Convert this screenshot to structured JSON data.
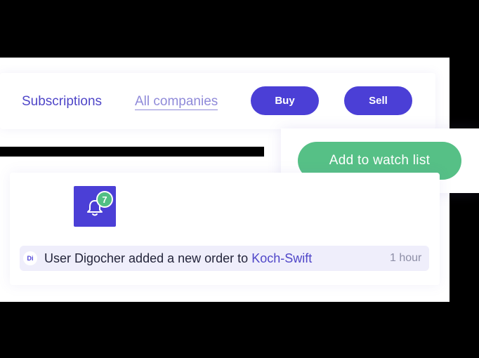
{
  "tabs": {
    "subscriptions": "Subscriptions",
    "all_companies": "All companies"
  },
  "actions": {
    "buy": "Buy",
    "sell": "Sell",
    "watch": "Add to watch list"
  },
  "notifications": {
    "badge_count": "7",
    "icon": "bell-icon"
  },
  "activity": {
    "avatar_initials": "Di",
    "message": "User Digocher added a new order to",
    "company": "Koch-Swift",
    "time": "1 hour"
  },
  "colors": {
    "primary": "#4b3fd6",
    "success": "#56c086",
    "badge": "#52bf84"
  }
}
